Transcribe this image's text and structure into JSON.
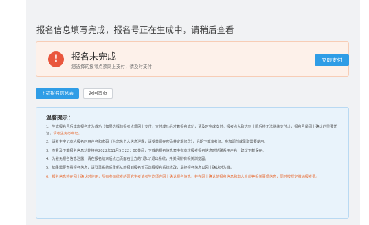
{
  "page": {
    "title": "报名信息填写完成，报名号正在生成中，请稍后查看"
  },
  "status": {
    "icon": "exclamation-icon",
    "title": "报名未完成",
    "subtitle": "您选择的报考点须网上支付，请及时支付！",
    "pay_button": "立即支付"
  },
  "actions": {
    "download_label": "下载报名信息表",
    "home_label": "返回首页"
  },
  "tips": {
    "title": "温馨提示：",
    "items": [
      {
        "text": "1、生成报名号后本次报名才为成功（如果选择的报考点须网上支付，支付成功后才算报名成功，请及时完成支付。报考点大致达到上限后将无法继续支付。），报名号是网上确认的重要凭证，",
        "highlight": "请考生务必牢记。",
        "orange": false
      },
      {
        "text": "2、请考生牢记本人报名时用户名和密码（为您务个人信息泄露，请妥善保存密码并定期修改），后期下载准考证、参加调剂或录取需要使用。",
        "highlight": "",
        "orange": false
      },
      {
        "text": "3、查看及下载报名信息功能将在2022年11月5日22：00关闭，下载的报名信息表中有本次报考报名信息时的联系用户名，建议下载保存。",
        "highlight": "",
        "orange": false
      },
      {
        "text": "4、为避免报名信息泄露，请在报名结束后点击页面右上方的\"退出\"退出系统，并关闭所有相关浏览器。",
        "highlight": "",
        "orange": false
      },
      {
        "text": "5、如果需要查看报名信息，请登录系统后重新从新报到报名首页选择报名系统修改，最终报名信息以网上确认时为准。",
        "highlight": "",
        "orange": false
      },
      {
        "text": "6、报名信息将在网上确认时使用，所有参加统考的研究生考试考生均须在网上确认报名信息，并在网上确认前报名信息和本人身份等相关事项信息，同时按规定缴纳报考费。",
        "highlight": "",
        "orange": true
      }
    ]
  },
  "colors": {
    "accent": "#2f9de6",
    "warning": "#e9573e",
    "highlight": "#e8703a"
  }
}
